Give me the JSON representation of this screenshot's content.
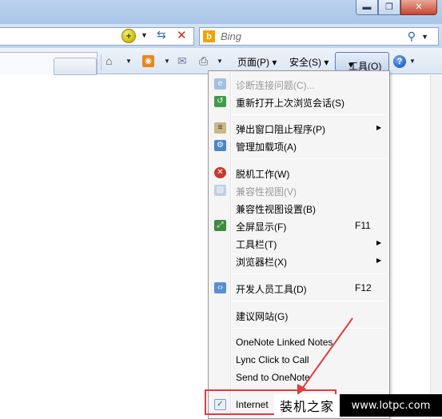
{
  "window": {
    "minimize_glyph": "▬",
    "restore_glyph": "❐",
    "close_glyph": "✕"
  },
  "search": {
    "placeholder": "Bing",
    "engine_icon": "b"
  },
  "command_bar": {
    "page_label": "页面(P)",
    "safety_label": "安全(S)",
    "tools_label": "工具(O)",
    "dropdown_arrow": "▾",
    "help_glyph": "?"
  },
  "tools_menu": {
    "items": [
      {
        "label": "诊断连接问题(C)...",
        "disabled": true,
        "icon": "network-diagnose-icon"
      },
      {
        "label": "重新打开上次浏览会话(S)",
        "icon": "reopen-session-icon"
      },
      {
        "label": "弹出窗口阻止程序(P)",
        "submenu": true,
        "icon": "popup-blocker-icon"
      },
      {
        "label": "管理加载项(A)",
        "icon": "addons-icon"
      },
      {
        "label": "脱机工作(W)",
        "icon": "offline-icon"
      },
      {
        "label": "兼容性视图(V)",
        "disabled": true,
        "icon": "compat-view-icon"
      },
      {
        "label": "兼容性视图设置(B)"
      },
      {
        "label": "全屏显示(F)",
        "shortcut": "F11",
        "icon": "fullscreen-icon"
      },
      {
        "label": "工具栏(T)",
        "submenu": true
      },
      {
        "label": "浏览器栏(X)",
        "submenu": true
      },
      {
        "label": "开发人员工具(D)",
        "shortcut": "F12",
        "icon": "dev-tools-icon"
      },
      {
        "label": "建议网站(G)"
      },
      {
        "label": "OneNote Linked Notes"
      },
      {
        "label": "Lync Click to Call"
      },
      {
        "label": "Send to OneNote"
      },
      {
        "label": "Internet",
        "icon": "internet-options-icon"
      }
    ],
    "submenu_arrow": "▶"
  },
  "watermark": {
    "site_name": "装机之家",
    "url": "www.lotpc.com"
  },
  "colors": {
    "highlight": "#e23b3b",
    "menu_bg": "#f5f5f5"
  }
}
